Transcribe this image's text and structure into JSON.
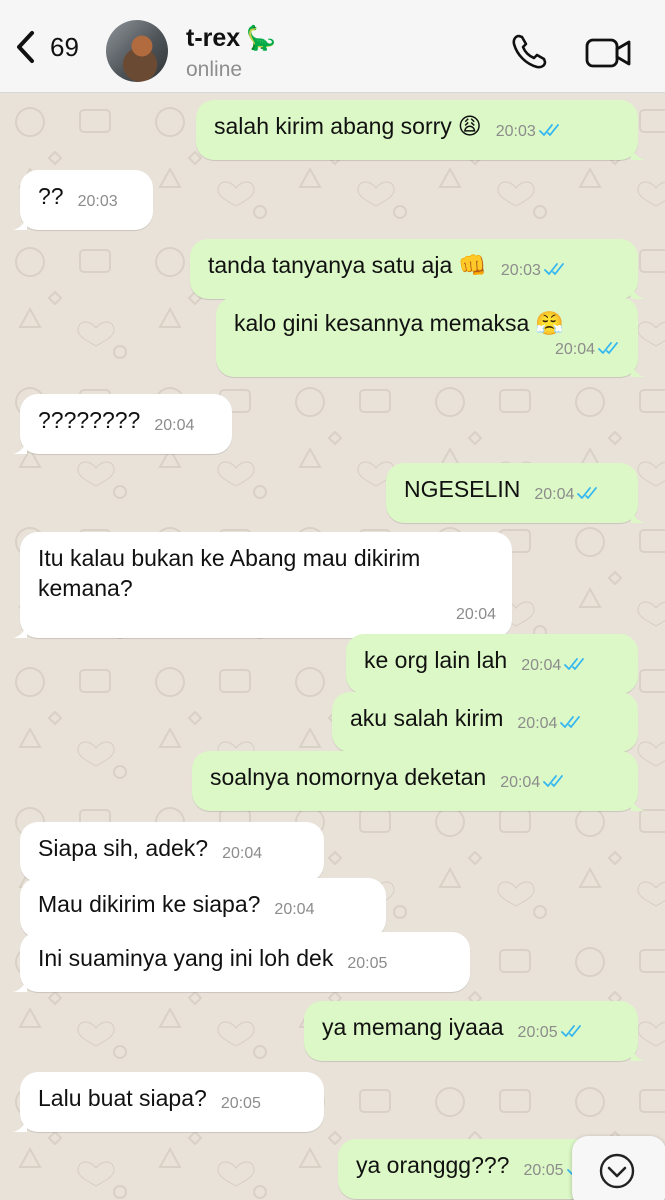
{
  "header": {
    "back_count": "69",
    "contact_name": "t-rex",
    "contact_emoji": "🦕",
    "status": "online",
    "icons": [
      "chevron-left-icon",
      "phone-icon",
      "video-camera-icon"
    ]
  },
  "messages": [
    {
      "dir": "out",
      "text": "salah kirim abang sorry",
      "emoji": "😩",
      "time": "20:03",
      "read": true
    },
    {
      "dir": "in",
      "text": "??",
      "time": "20:03"
    },
    {
      "dir": "out",
      "text": "tanda tanyanya satu aja",
      "emoji": "👊",
      "time": "20:03",
      "read": true
    },
    {
      "dir": "out",
      "text": "kalo gini kesannya memaksa",
      "emoji": "😤",
      "time": "20:04",
      "read": true
    },
    {
      "dir": "in",
      "text": "????????",
      "time": "20:04"
    },
    {
      "dir": "out",
      "text": "NGESELIN",
      "time": "20:04",
      "read": true
    },
    {
      "dir": "in",
      "text": "Itu kalau bukan ke Abang mau dikirim kemana?",
      "time": "20:04"
    },
    {
      "dir": "out",
      "text": "ke org lain lah",
      "time": "20:04",
      "read": true
    },
    {
      "dir": "out",
      "text": "aku salah kirim",
      "time": "20:04",
      "read": true
    },
    {
      "dir": "out",
      "text": "soalnya nomornya deketan",
      "time": "20:04",
      "read": true
    },
    {
      "dir": "in",
      "text": "Siapa sih, adek?",
      "time": "20:04"
    },
    {
      "dir": "in",
      "text": "Mau dikirim ke siapa?",
      "time": "20:04"
    },
    {
      "dir": "in",
      "text": "Ini suaminya yang ini loh dek",
      "time": "20:05"
    },
    {
      "dir": "out",
      "text": "ya memang iyaaa",
      "time": "20:05",
      "read": true
    },
    {
      "dir": "in",
      "text": "Lalu buat siapa?",
      "time": "20:05"
    },
    {
      "dir": "out",
      "text": "ya oranggg???",
      "time": "20:05",
      "read": true
    }
  ],
  "colors": {
    "outgoing_bubble": "#dcf8c6",
    "incoming_bubble": "#ffffff",
    "chat_background": "#e9e2d9",
    "read_ticks": "#34b7f1"
  },
  "scroll_button_icon": "chevron-down-circle-icon"
}
